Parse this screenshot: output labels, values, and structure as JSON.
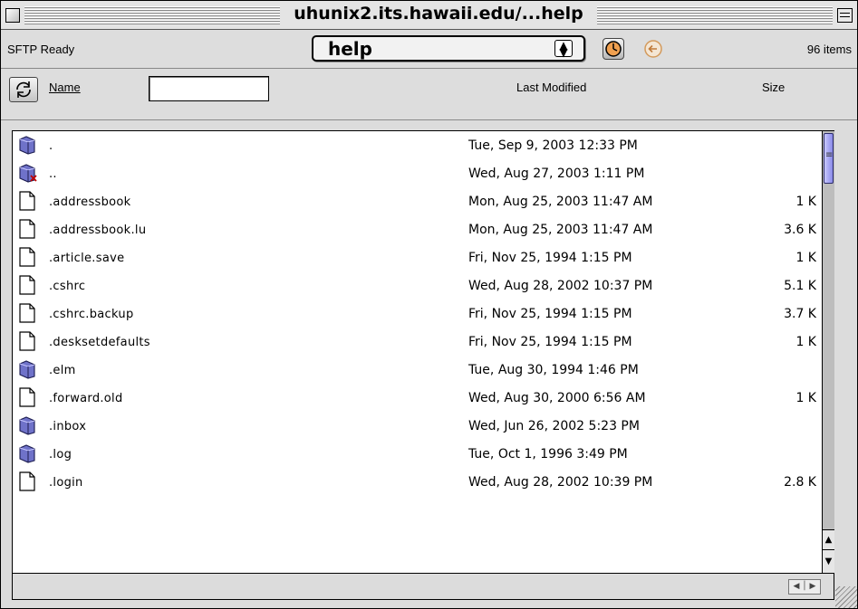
{
  "window": {
    "title": "uhunix2.its.hawaii.edu/...help"
  },
  "toolbar": {
    "status": "SFTP Ready",
    "path": "help",
    "item_count": "96 items"
  },
  "header": {
    "name_col": "Name",
    "modified_col": "Last Modified",
    "size_col": "Size",
    "filter_value": ""
  },
  "files": [
    {
      "icon": "folder-icon",
      "name": ".",
      "modified": "Tue, Sep 9, 2003 12:33 PM",
      "size": ""
    },
    {
      "icon": "folder-up-icon",
      "name": "..",
      "modified": "Wed, Aug 27, 2003 1:11 PM",
      "size": ""
    },
    {
      "icon": "document-icon",
      "name": ".addressbook",
      "modified": "Mon, Aug 25, 2003 11:47 AM",
      "size": "1 K"
    },
    {
      "icon": "document-icon",
      "name": ".addressbook.lu",
      "modified": "Mon, Aug 25, 2003 11:47 AM",
      "size": "3.6 K"
    },
    {
      "icon": "document-icon",
      "name": ".article.save",
      "modified": "Fri, Nov 25, 1994 1:15 PM",
      "size": "1 K"
    },
    {
      "icon": "document-icon",
      "name": ".cshrc",
      "modified": "Wed, Aug 28, 2002 10:37 PM",
      "size": "5.1 K"
    },
    {
      "icon": "document-icon",
      "name": ".cshrc.backup",
      "modified": "Fri, Nov 25, 1994 1:15 PM",
      "size": "3.7 K"
    },
    {
      "icon": "document-icon",
      "name": ".desksetdefaults",
      "modified": "Fri, Nov 25, 1994 1:15 PM",
      "size": "1 K"
    },
    {
      "icon": "folder-icon",
      "name": ".elm",
      "modified": "Tue, Aug 30, 1994 1:46 PM",
      "size": ""
    },
    {
      "icon": "document-icon",
      "name": ".forward.old",
      "modified": "Wed, Aug 30, 2000 6:56 AM",
      "size": "1 K"
    },
    {
      "icon": "folder-icon",
      "name": ".inbox",
      "modified": "Wed, Jun 26, 2002 5:23 PM",
      "size": ""
    },
    {
      "icon": "folder-icon",
      "name": ".log",
      "modified": "Tue, Oct 1, 1996 3:49 PM",
      "size": ""
    },
    {
      "icon": "document-icon",
      "name": ".login",
      "modified": "Wed, Aug 28, 2002 10:39 PM",
      "size": "2.8 K"
    }
  ],
  "colors": {
    "folder": "#6f72c9",
    "scroll_thumb": "#9a9af0",
    "window_bg": "#dcdcdc"
  }
}
